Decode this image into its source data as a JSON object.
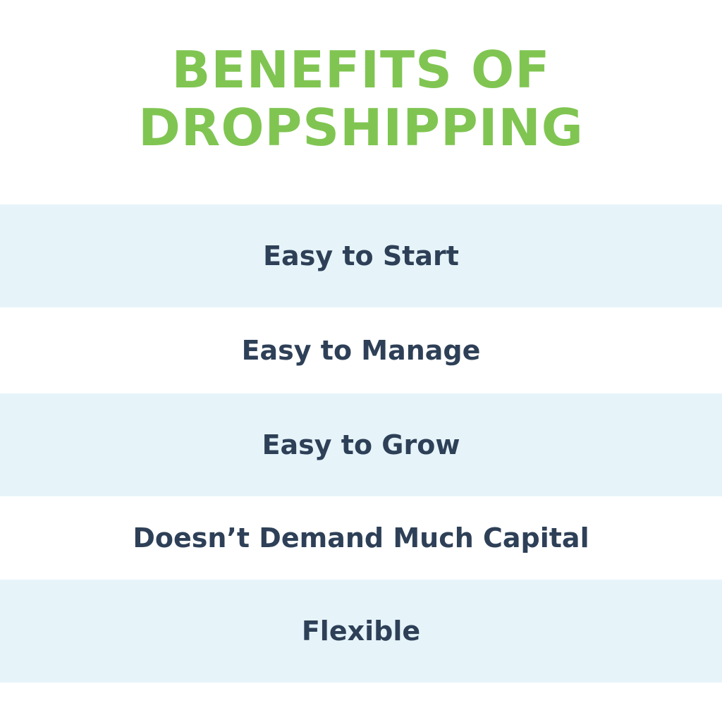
{
  "title": {
    "line1": "BENEFITS OF",
    "line2": "DROPSHIPPING"
  },
  "benefits": [
    {
      "label": "Easy to Start"
    },
    {
      "label": "Easy to Manage"
    },
    {
      "label": "Easy to Grow"
    },
    {
      "label": "Doesn’t Demand Much Capital"
    },
    {
      "label": "Flexible"
    }
  ],
  "colors": {
    "title": "#80c552",
    "text": "#2e4057",
    "band": "#e6f4fa",
    "background": "#ffffff"
  }
}
